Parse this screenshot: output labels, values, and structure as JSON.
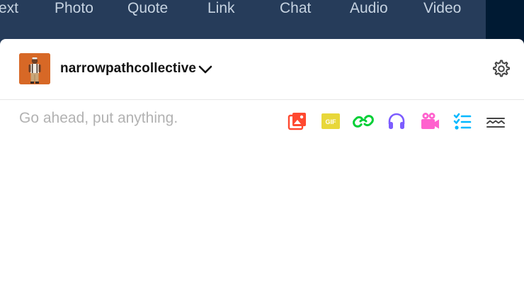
{
  "topnav": {
    "tabs": [
      {
        "label": "Text"
      },
      {
        "label": "Photo"
      },
      {
        "label": "Quote"
      },
      {
        "label": "Link"
      },
      {
        "label": "Chat"
      },
      {
        "label": "Audio"
      },
      {
        "label": "Video"
      }
    ],
    "visible_first_tab_fragment": "ext"
  },
  "composer": {
    "blog_name": "narrowpathcollective",
    "placeholder": "Go ahead, put anything.",
    "tools": [
      {
        "name": "photo-tool",
        "icon": "image-icon",
        "color": "#ff4930"
      },
      {
        "name": "gif-tool",
        "icon": "gif-icon",
        "label": "GIF",
        "color": "#e8d73a"
      },
      {
        "name": "link-tool",
        "icon": "link-icon",
        "color": "#00cf35"
      },
      {
        "name": "audio-tool",
        "icon": "headphones-icon",
        "color": "#7c5cff"
      },
      {
        "name": "video-tool",
        "icon": "video-camera-icon",
        "color": "#ff62ce"
      },
      {
        "name": "list-tool",
        "icon": "checklist-icon",
        "color": "#00b8ff"
      },
      {
        "name": "read-more-tool",
        "icon": "read-more-icon",
        "color": "#444444"
      }
    ]
  }
}
